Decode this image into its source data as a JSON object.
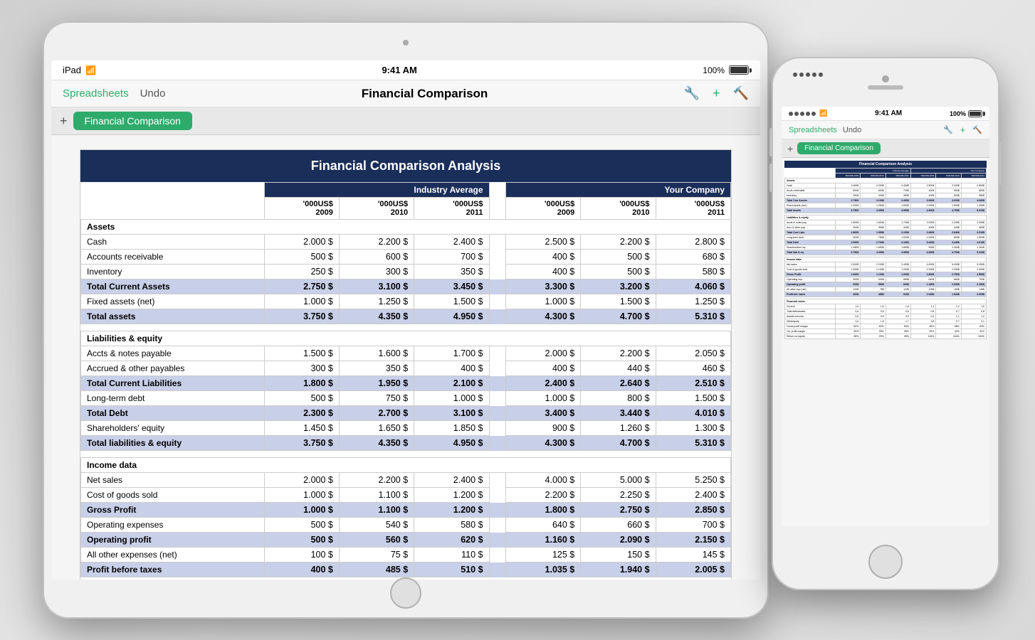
{
  "scene": {
    "background": "#e0e0e0"
  },
  "ipad": {
    "status": {
      "device": "iPad",
      "wifi": "WiFi",
      "time": "9:41 AM",
      "battery": "100%"
    },
    "toolbar": {
      "spreadsheets_label": "Spreadsheets",
      "undo_label": "Undo",
      "title": "Financial Comparison"
    },
    "tab": {
      "add_icon": "+",
      "sheet_name": "Financial Comparison"
    }
  },
  "iphone": {
    "status": {
      "time": "9:41 AM",
      "battery": "100%"
    },
    "toolbar": {
      "spreadsheets_label": "Spreadsheets",
      "undo_label": "Undo"
    },
    "tab": {
      "sheet_name": "Financial Comparison"
    }
  },
  "spreadsheet": {
    "title": "Financial Comparison Analysis",
    "col_groups": {
      "industry": "Industry Average",
      "company": "Your Company"
    },
    "col_years": [
      "'000US$ 2009",
      "'000US$ 2010",
      "'000US$ 2011"
    ],
    "sections": [
      {
        "name": "Assets",
        "rows": [
          {
            "label": "Cash",
            "i2009": "2.000 $",
            "i2010": "2.200 $",
            "i2011": "2.400 $",
            "c2009": "2.500 $",
            "c2010": "2.200 $",
            "c2011": "2.800 $"
          },
          {
            "label": "Accounts receivable",
            "i2009": "500 $",
            "i2010": "600 $",
            "i2011": "700 $",
            "c2009": "400 $",
            "c2010": "500 $",
            "c2011": "680 $"
          },
          {
            "label": "Inventory",
            "i2009": "250 $",
            "i2010": "300 $",
            "i2011": "350 $",
            "c2009": "400 $",
            "c2010": "500 $",
            "c2011": "580 $"
          },
          {
            "label": "Total Current Assets",
            "i2009": "2.750 $",
            "i2010": "3.100 $",
            "i2011": "3.450 $",
            "c2009": "3.300 $",
            "c2010": "3.200 $",
            "c2011": "4.060 $",
            "is_total": true
          },
          {
            "label": "Fixed assets (net)",
            "i2009": "1.000 $",
            "i2010": "1.250 $",
            "i2011": "1.500 $",
            "c2009": "1.000 $",
            "c2010": "1.500 $",
            "c2011": "1.250 $"
          }
        ],
        "total": {
          "label": "Total assets",
          "i2009": "3.750 $",
          "i2010": "4.350 $",
          "i2011": "4.950 $",
          "c2009": "4.300 $",
          "c2010": "4.700 $",
          "c2011": "5.310 $"
        }
      },
      {
        "name": "Liabilities & equity",
        "rows": [
          {
            "label": "Accts & notes payable",
            "i2009": "1.500 $",
            "i2010": "1.600 $",
            "i2011": "1.700 $",
            "c2009": "2.000 $",
            "c2010": "2.200 $",
            "c2011": "2.050 $"
          },
          {
            "label": "Accrued & other payables",
            "i2009": "300 $",
            "i2010": "350 $",
            "i2011": "400 $",
            "c2009": "400 $",
            "c2010": "440 $",
            "c2011": "460 $"
          },
          {
            "label": "Total Current Liabilities",
            "i2009": "1.800 $",
            "i2010": "1.950 $",
            "i2011": "2.100 $",
            "c2009": "2.400 $",
            "c2010": "2.640 $",
            "c2011": "2.510 $",
            "is_total": true
          },
          {
            "label": "Long-term debt",
            "i2009": "500 $",
            "i2010": "750 $",
            "i2011": "1.000 $",
            "c2009": "1.000 $",
            "c2010": "800 $",
            "c2011": "1.500 $"
          },
          {
            "label": "Total Debt",
            "i2009": "2.300 $",
            "i2010": "2.700 $",
            "i2011": "3.100 $",
            "c2009": "3.400 $",
            "c2010": "3.440 $",
            "c2011": "4.010 $",
            "is_total": true
          },
          {
            "label": "Shareholders' equity",
            "i2009": "1.450 $",
            "i2010": "1.650 $",
            "i2011": "1.850 $",
            "c2009": "900 $",
            "c2010": "1.260 $",
            "c2011": "1.300 $"
          }
        ],
        "total": {
          "label": "Total liabilities & equity",
          "i2009": "3.750 $",
          "i2010": "4.350 $",
          "i2011": "4.950 $",
          "c2009": "4.300 $",
          "c2010": "4.700 $",
          "c2011": "5.310 $"
        }
      },
      {
        "name": "Income data",
        "rows": [
          {
            "label": "Net sales",
            "i2009": "2.000 $",
            "i2010": "2.200 $",
            "i2011": "2.400 $",
            "c2009": "4.000 $",
            "c2010": "5.000 $",
            "c2011": "5.250 $"
          },
          {
            "label": "Cost of goods sold",
            "i2009": "1.000 $",
            "i2010": "1.100 $",
            "i2011": "1.200 $",
            "c2009": "2.200 $",
            "c2010": "2.250 $",
            "c2011": "2.400 $"
          },
          {
            "label": "Gross Profit",
            "i2009": "1.000 $",
            "i2010": "1.100 $",
            "i2011": "1.200 $",
            "c2009": "1.800 $",
            "c2010": "2.750 $",
            "c2011": "2.850 $",
            "is_total": true
          },
          {
            "label": "Operating expenses",
            "i2009": "500 $",
            "i2010": "540 $",
            "i2011": "580 $",
            "c2009": "640 $",
            "c2010": "660 $",
            "c2011": "700 $"
          },
          {
            "label": "Operating profit",
            "i2009": "500 $",
            "i2010": "560 $",
            "i2011": "620 $",
            "c2009": "1.160 $",
            "c2010": "2.090 $",
            "c2011": "2.150 $",
            "is_total": true
          },
          {
            "label": "All other expenses (net)",
            "i2009": "100 $",
            "i2010": "75 $",
            "i2011": "110 $",
            "c2009": "125 $",
            "c2010": "150 $",
            "c2011": "145 $"
          }
        ],
        "total": {
          "label": "Profit before taxes",
          "i2009": "400 $",
          "i2010": "485 $",
          "i2011": "510 $",
          "c2009": "1.035 $",
          "c2010": "1.940 $",
          "c2011": "2.005 $"
        }
      },
      {
        "name": "Financial ratios",
        "rows": [
          {
            "label": "Current",
            "i2009": "1,5",
            "i2010": "1,6",
            "i2011": "1,6",
            "c2009": "1,4",
            "c2010": "1,2",
            "c2011": "1,6"
          },
          {
            "label": "Total debt/total assets",
            "i2009": "0,6",
            "i2010": "0,6",
            "i2011": "0,6",
            "c2009": "0,8",
            "c2010": "0,7",
            "c2011": "0,8"
          }
        ]
      }
    ]
  }
}
